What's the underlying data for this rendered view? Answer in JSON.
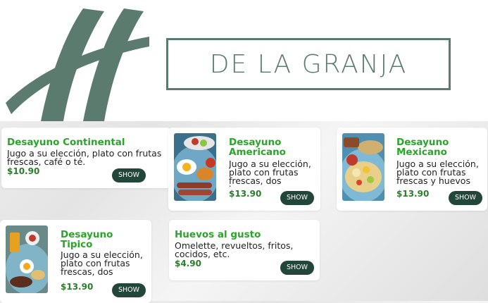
{
  "brand": {
    "name": "DE LA GRANJA",
    "accent_color": "#5a7b6d",
    "logo_icon": "h-leaf-logo-icon"
  },
  "menu_items": [
    {
      "title": "Desayuno Continental",
      "description": "Jugo a su elección, plato con frutas frescas, café o té.",
      "price": "$10.90",
      "button": "SHOW",
      "image": null
    },
    {
      "title": "Desayuno Americano",
      "description": "Jugo a su elección, plato con frutas frescas, dos huevos",
      "price": "$13.90",
      "button": "SHOW",
      "image": "american-breakfast-photo"
    },
    {
      "title": "Desayuno Mexicano",
      "description": "Jugo a su elección, plato con frutas frescas y huevos",
      "price": "$13.90",
      "button": "SHOW",
      "image": "mexican-breakfast-photo"
    },
    {
      "title": "Desayuno Tipico",
      "description": "Jugo a su elección, plato con frutas frescas, dos",
      "price": "$13.90",
      "button": "SHOW",
      "image": "typical-breakfast-photo"
    },
    {
      "title": "Huevos al gusto",
      "description": "Omelette, revueltos, fritos, cocidos, etc.",
      "price": "$4.90",
      "button": "SHOW",
      "image": null
    }
  ],
  "colors": {
    "title_green": "#2aa52a",
    "price_green": "#2a7d2a",
    "button_bg": "#22463a"
  }
}
